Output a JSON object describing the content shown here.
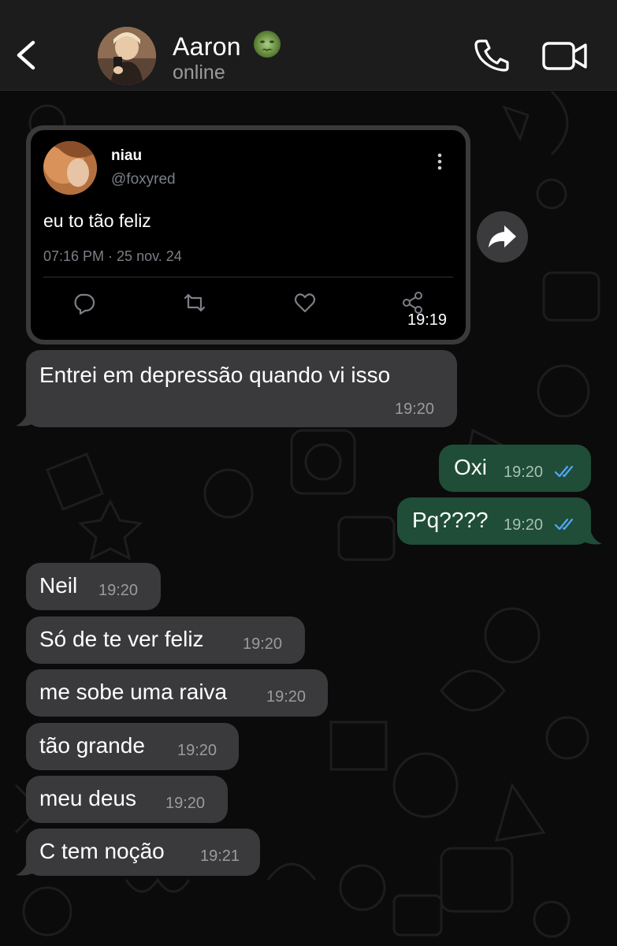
{
  "header": {
    "contact_name": "Aaron",
    "status": "online",
    "back_icon": "chevron-left-icon",
    "call_icon": "phone-icon",
    "video_icon": "video-camera-icon",
    "emoji": "nauseated-face-emoji"
  },
  "tweet": {
    "name": "niau",
    "handle": "@foxyred",
    "text": "eu to tão feliz",
    "date": "07:16 PM · 25 nov. 24",
    "time": "19:19",
    "actions": [
      "reply-icon",
      "retweet-icon",
      "like-icon",
      "share-icon"
    ]
  },
  "messages": [
    {
      "dir": "in",
      "text": "Entrei em depressão quando vi isso",
      "time": "19:20"
    },
    {
      "dir": "out",
      "text": "Oxi",
      "time": "19:20",
      "status": "read"
    },
    {
      "dir": "out",
      "text": "Pq????",
      "time": "19:20",
      "status": "read"
    },
    {
      "dir": "in",
      "text": "Neil",
      "time": "19:20"
    },
    {
      "dir": "in",
      "text": "Só de te ver feliz",
      "time": "19:20"
    },
    {
      "dir": "in",
      "text": "me sobe uma raiva",
      "time": "19:20"
    },
    {
      "dir": "in",
      "text": "tão grande",
      "time": "19:20"
    },
    {
      "dir": "in",
      "text": "meu deus",
      "time": "19:20"
    },
    {
      "dir": "in",
      "text": "C tem noção",
      "time": "19:21"
    }
  ],
  "colors": {
    "header_bg": "#1c1c1c",
    "incoming_bubble": "#3a3a3c",
    "outgoing_bubble": "#1f4d38",
    "read_ticks": "#53a6ff",
    "wallpaper_bg": "#0b0b0b"
  }
}
